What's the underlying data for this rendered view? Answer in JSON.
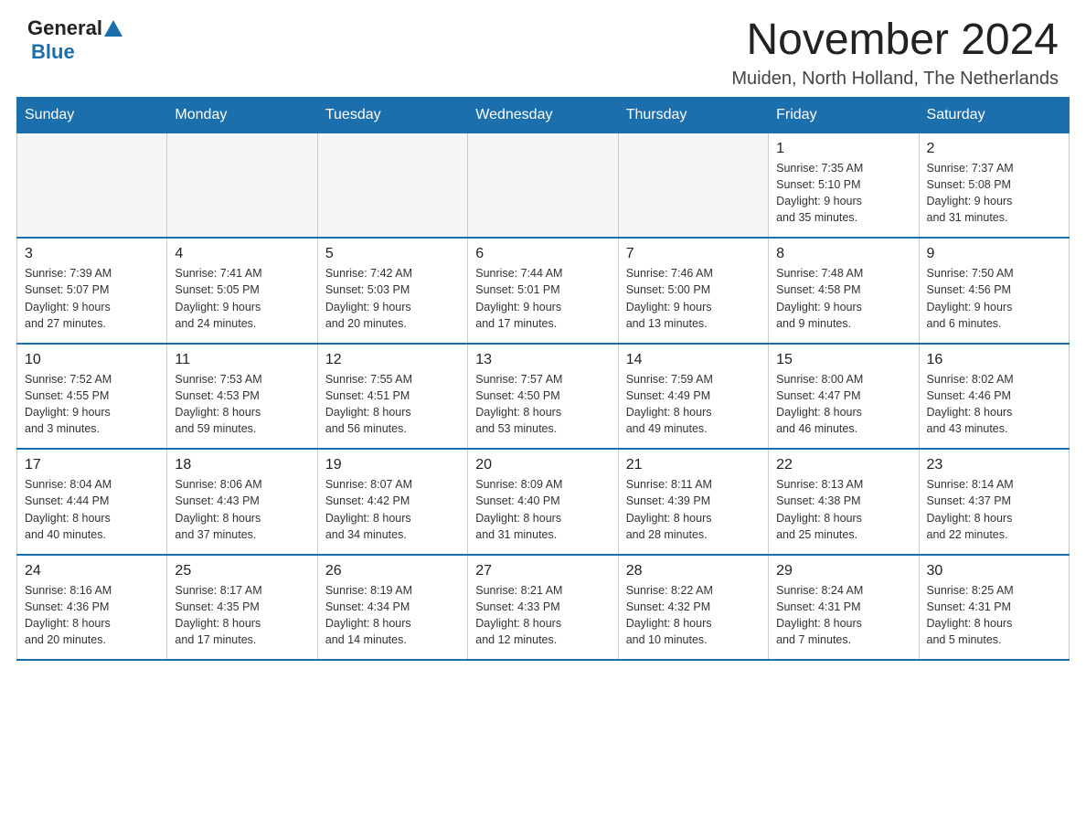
{
  "header": {
    "logo_general": "General",
    "logo_blue": "Blue",
    "month_title": "November 2024",
    "location": "Muiden, North Holland, The Netherlands"
  },
  "days_of_week": [
    "Sunday",
    "Monday",
    "Tuesday",
    "Wednesday",
    "Thursday",
    "Friday",
    "Saturday"
  ],
  "weeks": [
    [
      {
        "day": "",
        "info": ""
      },
      {
        "day": "",
        "info": ""
      },
      {
        "day": "",
        "info": ""
      },
      {
        "day": "",
        "info": ""
      },
      {
        "day": "",
        "info": ""
      },
      {
        "day": "1",
        "info": "Sunrise: 7:35 AM\nSunset: 5:10 PM\nDaylight: 9 hours\nand 35 minutes."
      },
      {
        "day": "2",
        "info": "Sunrise: 7:37 AM\nSunset: 5:08 PM\nDaylight: 9 hours\nand 31 minutes."
      }
    ],
    [
      {
        "day": "3",
        "info": "Sunrise: 7:39 AM\nSunset: 5:07 PM\nDaylight: 9 hours\nand 27 minutes."
      },
      {
        "day": "4",
        "info": "Sunrise: 7:41 AM\nSunset: 5:05 PM\nDaylight: 9 hours\nand 24 minutes."
      },
      {
        "day": "5",
        "info": "Sunrise: 7:42 AM\nSunset: 5:03 PM\nDaylight: 9 hours\nand 20 minutes."
      },
      {
        "day": "6",
        "info": "Sunrise: 7:44 AM\nSunset: 5:01 PM\nDaylight: 9 hours\nand 17 minutes."
      },
      {
        "day": "7",
        "info": "Sunrise: 7:46 AM\nSunset: 5:00 PM\nDaylight: 9 hours\nand 13 minutes."
      },
      {
        "day": "8",
        "info": "Sunrise: 7:48 AM\nSunset: 4:58 PM\nDaylight: 9 hours\nand 9 minutes."
      },
      {
        "day": "9",
        "info": "Sunrise: 7:50 AM\nSunset: 4:56 PM\nDaylight: 9 hours\nand 6 minutes."
      }
    ],
    [
      {
        "day": "10",
        "info": "Sunrise: 7:52 AM\nSunset: 4:55 PM\nDaylight: 9 hours\nand 3 minutes."
      },
      {
        "day": "11",
        "info": "Sunrise: 7:53 AM\nSunset: 4:53 PM\nDaylight: 8 hours\nand 59 minutes."
      },
      {
        "day": "12",
        "info": "Sunrise: 7:55 AM\nSunset: 4:51 PM\nDaylight: 8 hours\nand 56 minutes."
      },
      {
        "day": "13",
        "info": "Sunrise: 7:57 AM\nSunset: 4:50 PM\nDaylight: 8 hours\nand 53 minutes."
      },
      {
        "day": "14",
        "info": "Sunrise: 7:59 AM\nSunset: 4:49 PM\nDaylight: 8 hours\nand 49 minutes."
      },
      {
        "day": "15",
        "info": "Sunrise: 8:00 AM\nSunset: 4:47 PM\nDaylight: 8 hours\nand 46 minutes."
      },
      {
        "day": "16",
        "info": "Sunrise: 8:02 AM\nSunset: 4:46 PM\nDaylight: 8 hours\nand 43 minutes."
      }
    ],
    [
      {
        "day": "17",
        "info": "Sunrise: 8:04 AM\nSunset: 4:44 PM\nDaylight: 8 hours\nand 40 minutes."
      },
      {
        "day": "18",
        "info": "Sunrise: 8:06 AM\nSunset: 4:43 PM\nDaylight: 8 hours\nand 37 minutes."
      },
      {
        "day": "19",
        "info": "Sunrise: 8:07 AM\nSunset: 4:42 PM\nDaylight: 8 hours\nand 34 minutes."
      },
      {
        "day": "20",
        "info": "Sunrise: 8:09 AM\nSunset: 4:40 PM\nDaylight: 8 hours\nand 31 minutes."
      },
      {
        "day": "21",
        "info": "Sunrise: 8:11 AM\nSunset: 4:39 PM\nDaylight: 8 hours\nand 28 minutes."
      },
      {
        "day": "22",
        "info": "Sunrise: 8:13 AM\nSunset: 4:38 PM\nDaylight: 8 hours\nand 25 minutes."
      },
      {
        "day": "23",
        "info": "Sunrise: 8:14 AM\nSunset: 4:37 PM\nDaylight: 8 hours\nand 22 minutes."
      }
    ],
    [
      {
        "day": "24",
        "info": "Sunrise: 8:16 AM\nSunset: 4:36 PM\nDaylight: 8 hours\nand 20 minutes."
      },
      {
        "day": "25",
        "info": "Sunrise: 8:17 AM\nSunset: 4:35 PM\nDaylight: 8 hours\nand 17 minutes."
      },
      {
        "day": "26",
        "info": "Sunrise: 8:19 AM\nSunset: 4:34 PM\nDaylight: 8 hours\nand 14 minutes."
      },
      {
        "day": "27",
        "info": "Sunrise: 8:21 AM\nSunset: 4:33 PM\nDaylight: 8 hours\nand 12 minutes."
      },
      {
        "day": "28",
        "info": "Sunrise: 8:22 AM\nSunset: 4:32 PM\nDaylight: 8 hours\nand 10 minutes."
      },
      {
        "day": "29",
        "info": "Sunrise: 8:24 AM\nSunset: 4:31 PM\nDaylight: 8 hours\nand 7 minutes."
      },
      {
        "day": "30",
        "info": "Sunrise: 8:25 AM\nSunset: 4:31 PM\nDaylight: 8 hours\nand 5 minutes."
      }
    ]
  ]
}
